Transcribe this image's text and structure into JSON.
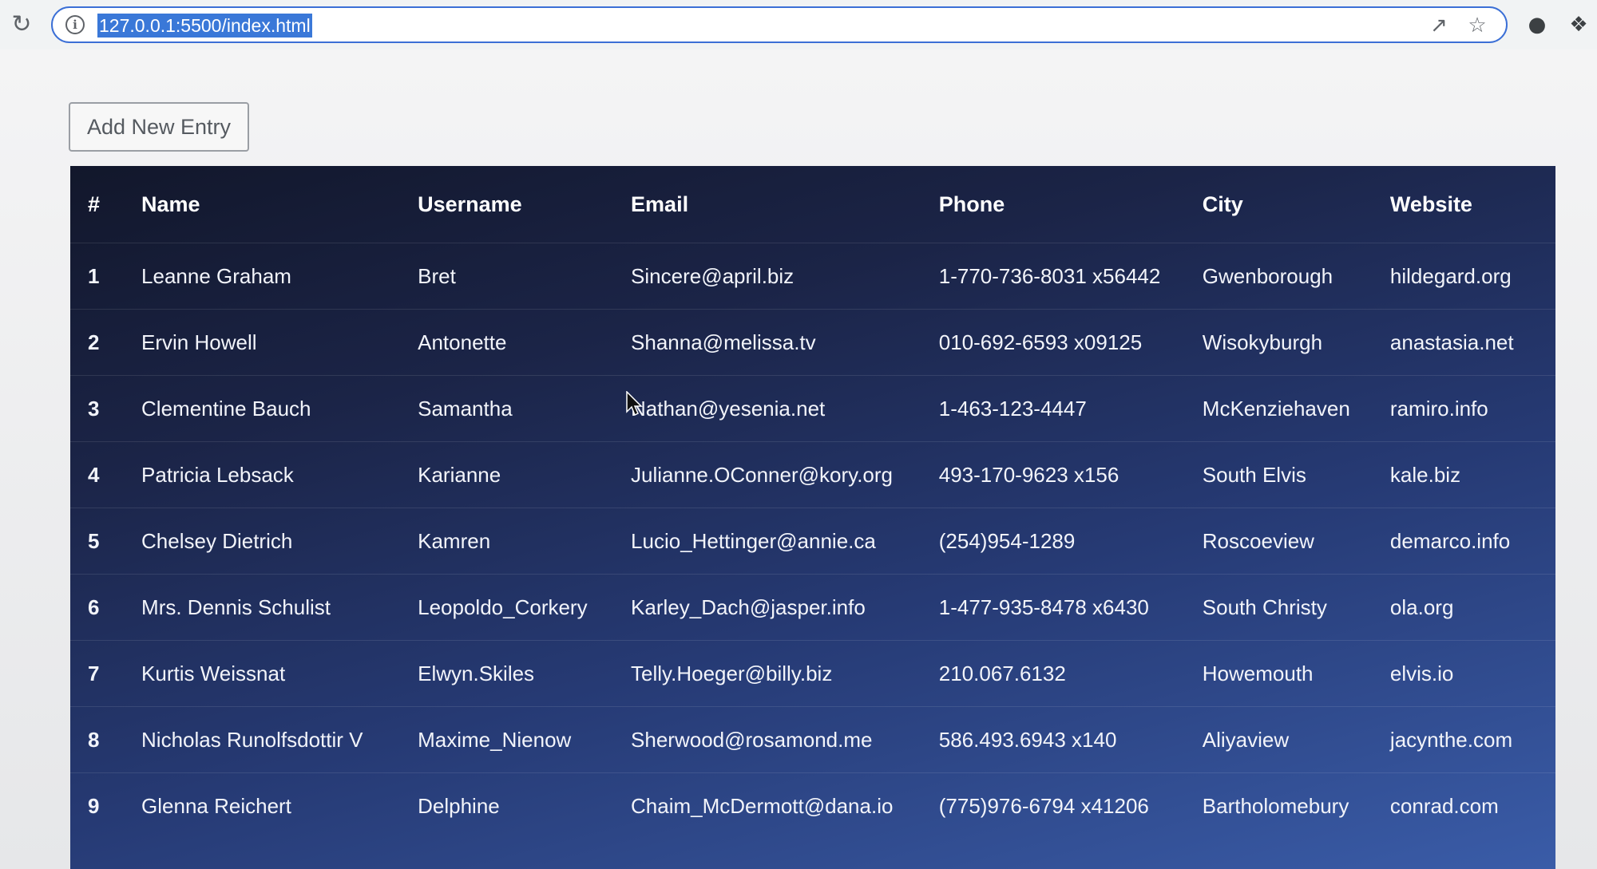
{
  "browser": {
    "url": "127.0.0.1:5500/index.html",
    "icons": {
      "reload": "reload-icon",
      "info": "info-icon",
      "share": "share-icon",
      "bookmark": "star-icon",
      "extension1": "extension-icon",
      "extension2": "puzzle-icon"
    }
  },
  "toolbar": {
    "add_label": "Add New Entry"
  },
  "table": {
    "headers": [
      "#",
      "Name",
      "Username",
      "Email",
      "Phone",
      "City",
      "Website"
    ],
    "rows": [
      [
        "1",
        "Leanne Graham",
        "Bret",
        "Sincere@april.biz",
        "1-770-736-8031 x56442",
        "Gwenborough",
        "hildegard.org"
      ],
      [
        "2",
        "Ervin Howell",
        "Antonette",
        "Shanna@melissa.tv",
        "010-692-6593 x09125",
        "Wisokyburgh",
        "anastasia.net"
      ],
      [
        "3",
        "Clementine Bauch",
        "Samantha",
        "Nathan@yesenia.net",
        "1-463-123-4447",
        "McKenziehaven",
        "ramiro.info"
      ],
      [
        "4",
        "Patricia Lebsack",
        "Karianne",
        "Julianne.OConner@kory.org",
        "493-170-9623 x156",
        "South Elvis",
        "kale.biz"
      ],
      [
        "5",
        "Chelsey Dietrich",
        "Kamren",
        "Lucio_Hettinger@annie.ca",
        "(254)954-1289",
        "Roscoeview",
        "demarco.info"
      ],
      [
        "6",
        "Mrs. Dennis Schulist",
        "Leopoldo_Corkery",
        "Karley_Dach@jasper.info",
        "1-477-935-8478 x6430",
        "South Christy",
        "ola.org"
      ],
      [
        "7",
        "Kurtis Weissnat",
        "Elwyn.Skiles",
        "Telly.Hoeger@billy.biz",
        "210.067.6132",
        "Howemouth",
        "elvis.io"
      ],
      [
        "8",
        "Nicholas Runolfsdottir V",
        "Maxime_Nienow",
        "Sherwood@rosamond.me",
        "586.493.6943 x140",
        "Aliyaview",
        "jacynthe.com"
      ],
      [
        "9",
        "Glenna Reichert",
        "Delphine",
        "Chaim_McDermott@dana.io",
        "(775)976-6794 x41206",
        "Bartholomebury",
        "conrad.com"
      ]
    ]
  },
  "colors": {
    "table_top": "#12172b",
    "table_bottom": "#3a5ca8",
    "url_highlight": "#3a78d8",
    "omnibox_border": "#3b6fd6"
  }
}
